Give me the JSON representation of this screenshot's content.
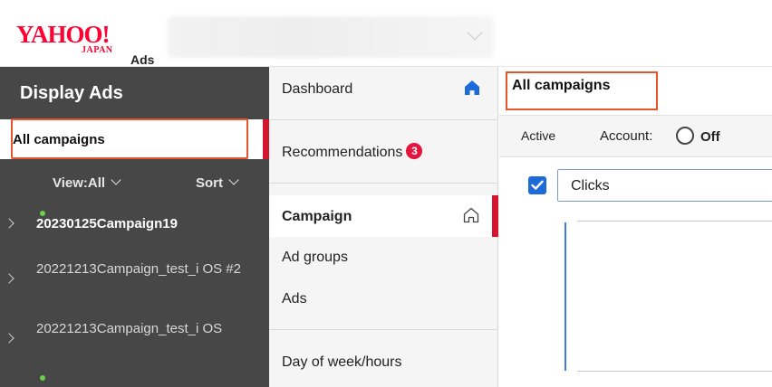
{
  "header": {
    "logo_main": "YAHOO!",
    "logo_japan": "JAPAN",
    "logo_ads": "Ads"
  },
  "sidebar": {
    "title": "Display Ads",
    "all_campaigns": "All campaigns",
    "view_label": "View:All",
    "sort_label": "Sort",
    "campaigns": [
      {
        "name": "20230125Campaign19",
        "active": true
      },
      {
        "name": "20221213Campaign_test_i OS #2",
        "active": false
      },
      {
        "name": "20221213Campaign_test_i OS",
        "active": false
      }
    ]
  },
  "midnav": {
    "dashboard": "Dashboard",
    "recommendations": "Recommendations",
    "recommendations_count": "3",
    "campaign": "Campaign",
    "ad_groups": "Ad groups",
    "ads": "Ads",
    "day_of_week": "Day of week/hours"
  },
  "main": {
    "title": "All campaigns",
    "active_label": "Active",
    "account_label": "Account:",
    "off_label": "Off",
    "metric": "Clicks"
  },
  "colors": {
    "accent_red": "#d6152f",
    "highlight_orange": "#e8542b",
    "checkbox_blue": "#1d6bd8",
    "sidebar_dark": "#474747",
    "status_green": "#6bd14a"
  }
}
